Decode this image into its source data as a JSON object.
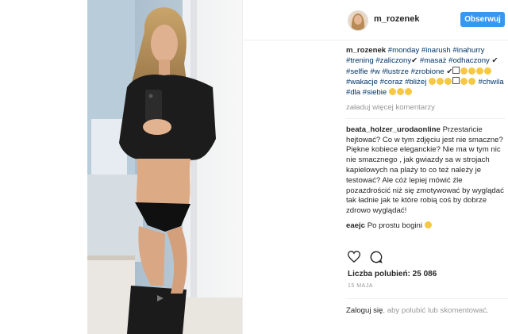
{
  "header": {
    "username": "m_rozenek",
    "follow_label": "Obserwuj"
  },
  "caption": {
    "username": "m_rozenek",
    "tags1": "#monday #inarush #inahurry #trening #zaliczony",
    "tags2": "#masaż #odhaczony",
    "tags3": "#selfie #w #lustrze #zrobione",
    "tags4": "#wakacje #coraz #bliżej",
    "tags5": "#chwila #dla #siebie",
    "check": "✔"
  },
  "load_more": "załaduj więcej komentarzy",
  "comments": [
    {
      "user": "beata_holzer_urodaonline",
      "text": "Przestańcie hejtować? Co w tym zdjęciu jest nie smaczne? Piękne kobiece eleganckie? Nie ma w tym nic nie smacznego , jak gwiazdy sa w strojach kapielowych na plaży to co też należy je testować? Ale cóż lepiej mówić źle pozazdrościć niż się zmotywować by wyglądać tak ładnie jak te które robią coś by dobrze zdrowo wyglądać!"
    },
    {
      "user": "eaejc",
      "text": "Po prostu bogini"
    }
  ],
  "likes_text": "Liczba polubień: 25 086",
  "date_text": "15 MAJA",
  "login": {
    "link": "Zaloguj się",
    "rest": ", aby polubić lub skomentować."
  },
  "icons": {
    "like": "heart-icon",
    "comment": "comment-icon"
  },
  "colors": {
    "accent": "#3897f0",
    "hashtag": "#003569",
    "text": "#262626",
    "muted": "#999999"
  }
}
